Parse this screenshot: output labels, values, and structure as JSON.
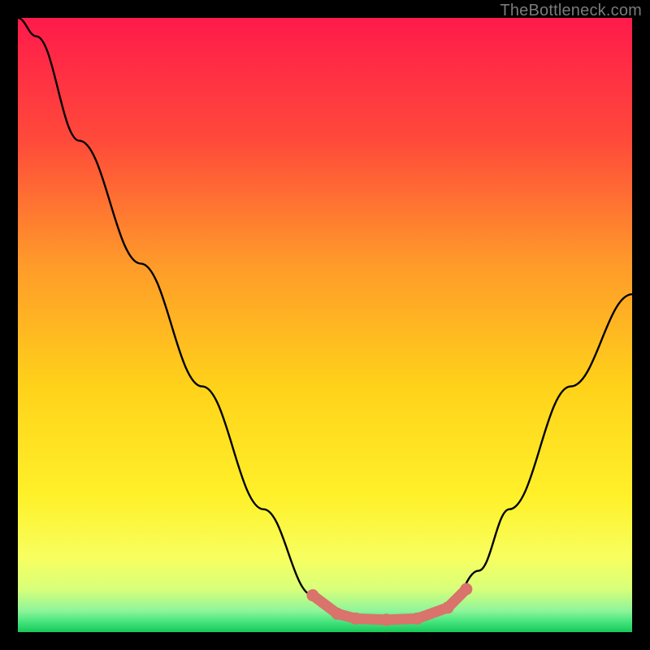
{
  "watermark": "TheBottleneck.com",
  "chart_data": {
    "type": "line",
    "title": "",
    "xlabel": "",
    "ylabel": "",
    "xlim": [
      0,
      100
    ],
    "ylim": [
      0,
      100
    ],
    "grid": false,
    "legend": false,
    "series": [
      {
        "name": "bottleneck-curve",
        "x": [
          0,
          3,
          10,
          20,
          30,
          40,
          48,
          52,
          55,
          60,
          65,
          70,
          75,
          80,
          90,
          100
        ],
        "y": [
          100,
          97,
          80,
          60,
          40,
          20,
          6,
          3,
          2,
          2,
          2,
          4,
          10,
          20,
          40,
          55
        ]
      }
    ],
    "optimal_range": {
      "name": "optimal-marker",
      "x": [
        48,
        52,
        55,
        60,
        65,
        70,
        73
      ],
      "y": [
        6,
        3,
        2.2,
        2,
        2.2,
        4,
        7
      ]
    },
    "gradient_stops": [
      {
        "offset": 0.0,
        "color": "#ff1a4b"
      },
      {
        "offset": 0.2,
        "color": "#ff4a3a"
      },
      {
        "offset": 0.4,
        "color": "#ff9a2a"
      },
      {
        "offset": 0.6,
        "color": "#ffd21a"
      },
      {
        "offset": 0.78,
        "color": "#fff12a"
      },
      {
        "offset": 0.88,
        "color": "#f7ff60"
      },
      {
        "offset": 0.93,
        "color": "#d8ff7a"
      },
      {
        "offset": 0.965,
        "color": "#8ff59a"
      },
      {
        "offset": 0.985,
        "color": "#3fe27a"
      },
      {
        "offset": 1.0,
        "color": "#18c85a"
      }
    ]
  }
}
